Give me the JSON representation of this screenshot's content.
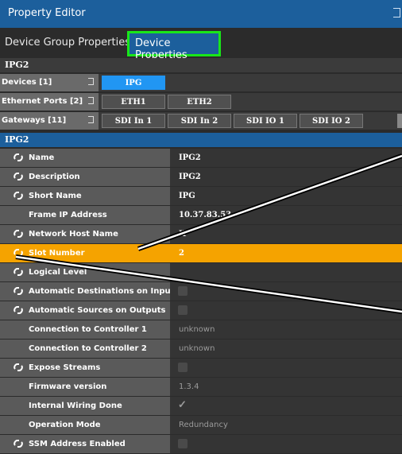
{
  "window": {
    "title": "Property Editor"
  },
  "tabs": [
    {
      "label": "Device Group Properties"
    },
    {
      "label": "Device Properties"
    }
  ],
  "group_name": "IPG2",
  "filters": [
    {
      "label": "Devices [1]",
      "chips": [
        "IPG"
      ]
    },
    {
      "label": "Ethernet Ports [2]",
      "chips": [
        "ETH1",
        "ETH2"
      ]
    },
    {
      "label": "Gateways [11]",
      "chips": [
        "SDI In 1",
        "SDI In 2",
        "SDI IO 1",
        "SDI IO 2"
      ]
    }
  ],
  "section_title": "IPG2",
  "properties": [
    {
      "name": "Name",
      "value": "IPG2",
      "linked": true
    },
    {
      "name": "Description",
      "value": "IPG2",
      "linked": true
    },
    {
      "name": "Short Name",
      "value": "IPG",
      "linked": true
    },
    {
      "name": "Frame IP Address",
      "value": "10.37.83.53",
      "linked": false
    },
    {
      "name": "Network Host Name",
      "value": "IP",
      "linked": true
    },
    {
      "name": "Slot Number",
      "value": "2",
      "linked": true,
      "highlighted": true
    },
    {
      "name": "Logical Level",
      "value": "",
      "linked": true
    },
    {
      "name": "Automatic Destinations on Inputs",
      "value": "",
      "linked": true,
      "checkbox": true
    },
    {
      "name": "Automatic Sources on Outputs",
      "value": "",
      "linked": true,
      "checkbox": true
    },
    {
      "name": "Connection to Controller 1",
      "value": "unknown",
      "linked": false
    },
    {
      "name": "Connection to Controller 2",
      "value": "unknown",
      "linked": false
    },
    {
      "name": "Expose Streams",
      "value": "",
      "linked": true,
      "checkbox": true
    },
    {
      "name": "Firmware version",
      "value": "1.3.4",
      "linked": false
    },
    {
      "name": "Internal Wiring Done",
      "value": "✓",
      "linked": false
    },
    {
      "name": "Operation Mode",
      "value": "Redundancy",
      "linked": false
    },
    {
      "name": "SSM Address Enabled",
      "value": "",
      "linked": true,
      "checkbox": true
    }
  ],
  "colors": {
    "accent": "#1c5f9c",
    "highlight": "#f5a300",
    "tab_outline": "#19e619",
    "selected_chip": "#2196f3"
  },
  "icons": {
    "link": "link-icon",
    "popout": "popout-icon"
  }
}
